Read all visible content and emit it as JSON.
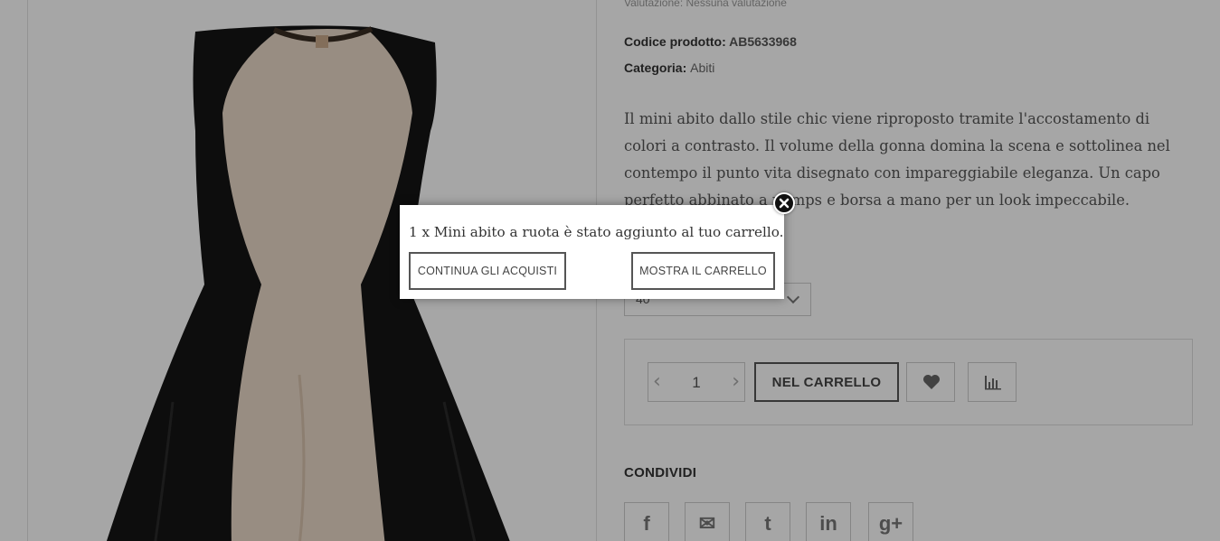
{
  "product": {
    "rating_text": "Valutazione: Nessuna valutazione",
    "code_label": "Codice prodotto:",
    "code_value": "AB5633968",
    "category_label": "Categoria:",
    "category_value": "Abiti",
    "description": "Il mini abito dallo stile chic viene riproposto tramite l'accostamento di colori a contrasto. Il volume della gonna domina la scena e sottolinea nel contempo il punto vita disegnato con impareggiabile eleganza. Un capo perfetto abbinato a pumps e borsa a mano per un look impeccabile.",
    "size_value": "40",
    "quantity": "1",
    "add_to_cart_label": "NEL CARRELLO",
    "share_title": "CONDIVIDI",
    "share_icons": [
      "facebook-icon",
      "mail-icon",
      "twitter-icon",
      "linkedin-icon",
      "google-plus-icon"
    ]
  },
  "popup": {
    "message": "1 x Mini abito a ruota è stato aggiunto al tuo carrello.",
    "continue_label": "CONTINUA GLI ACQUISTI",
    "show_cart_label": "MOSTRA IL CARRELLO"
  },
  "colors": {
    "overlay": "rgba(0,0,0,0.35)",
    "dress_dark": "#141414",
    "dress_panel": "#ead9c8",
    "button_border": "#555555"
  }
}
